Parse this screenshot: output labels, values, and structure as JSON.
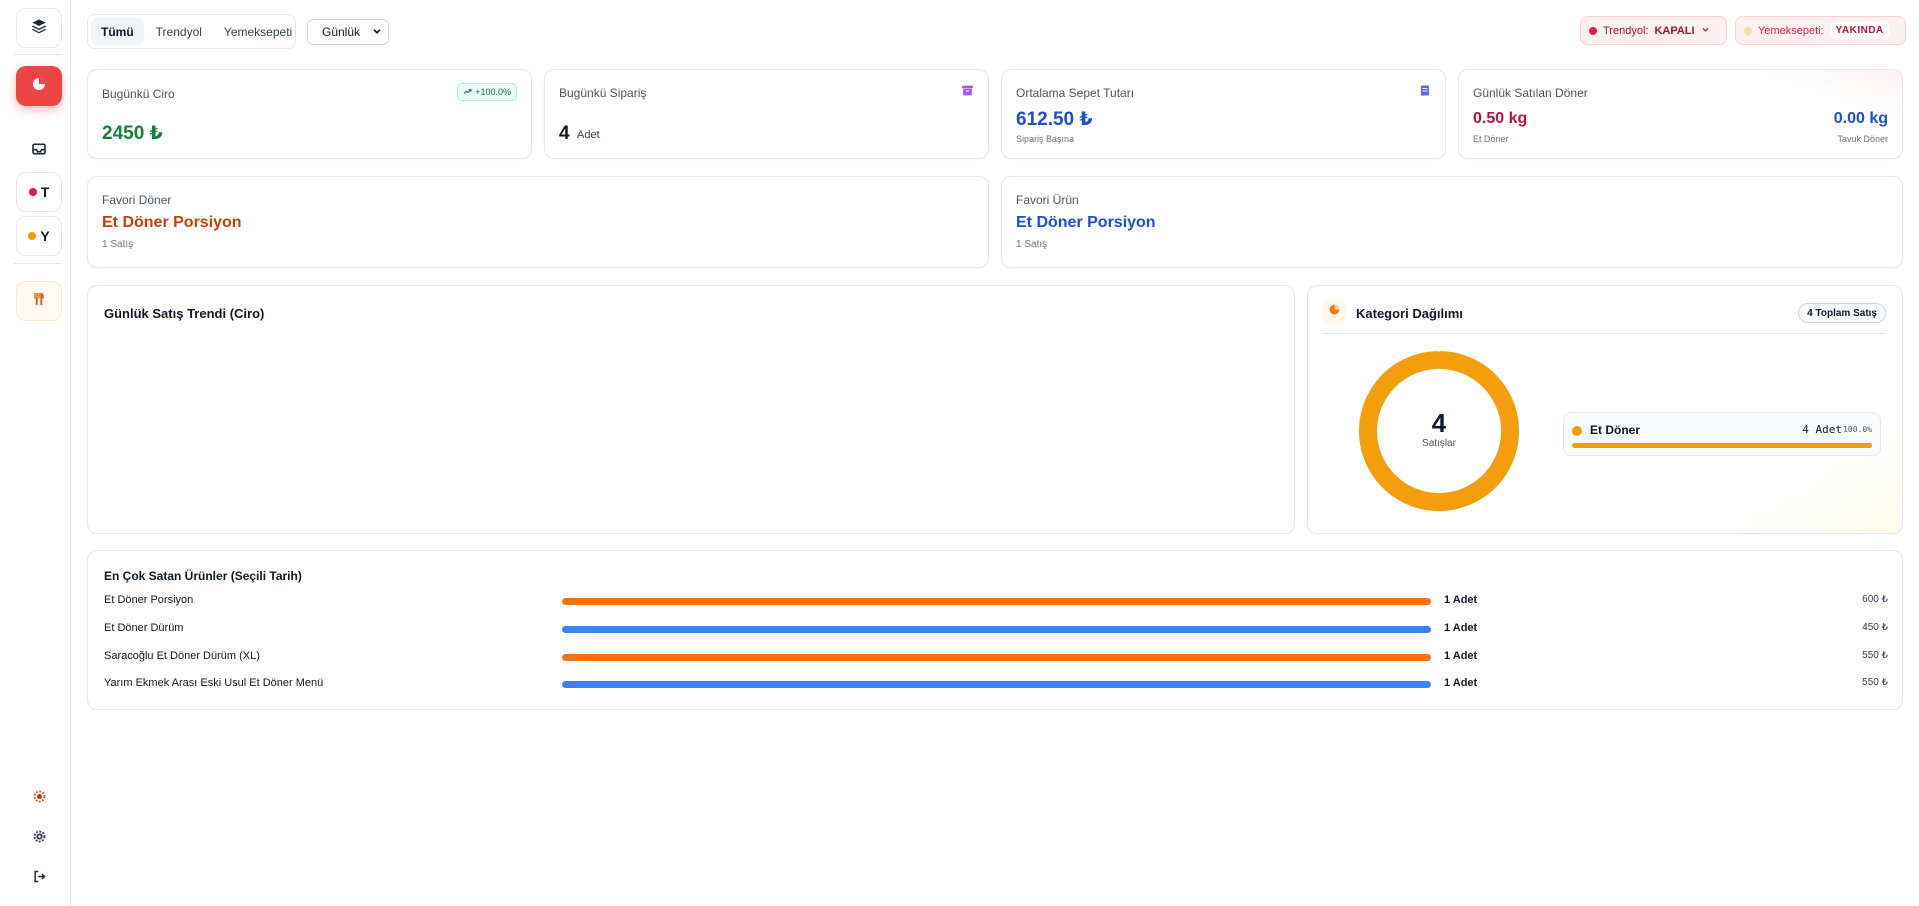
{
  "colors": {
    "accent_red": "#ef4444",
    "green": "#15803d",
    "blue": "#1d4ed8",
    "orange_text": "#c2410c",
    "crimson": "#be123c",
    "donut": "#f59e0b",
    "bar_orange": "#f97316",
    "bar_blue": "#3b82f6"
  },
  "sidebar": {
    "icons": [
      "layers-icon",
      "pie-chart-icon",
      "inbox-icon",
      "fork-knife-icon",
      "settings-red-icon",
      "settings-icon",
      "logout-icon"
    ],
    "platform_t": "T",
    "platform_y": "Y"
  },
  "topbar": {
    "tabs": [
      "Tümü",
      "Trendyol",
      "Yemeksepeti"
    ],
    "period": "Günlük",
    "trendyol": {
      "label": "Trendyol:",
      "status": "KAPALI"
    },
    "yemeksepeti": {
      "label": "Yemeksepeti:",
      "status": "YAKINDA"
    }
  },
  "stats": {
    "ciro": {
      "label": "Bugünkü Ciro",
      "value": "2450 ₺",
      "change": "+100.0%"
    },
    "siparis": {
      "label": "Bugünkü Sipariş",
      "value": "4",
      "unit": "Adet"
    },
    "sepet": {
      "label": "Ortalama Sepet Tutarı",
      "value": "612.50 ₺",
      "sub": "Sipariş Başına"
    },
    "doner": {
      "label": "Günlük Satılan Döner",
      "et_value": "0.50 kg",
      "et_label": "Et Döner",
      "tavuk_value": "0.00 kg",
      "tavuk_label": "Tavuk Döner"
    }
  },
  "favorites": {
    "doner": {
      "label": "Favori Döner",
      "name": "Et Döner Porsiyon",
      "sub": "1 Satış"
    },
    "urun": {
      "label": "Favori Ürün",
      "name": "Et Döner Porsiyon",
      "sub": "1 Satış"
    }
  },
  "trend": {
    "title": "Günlük Satış Trendi (Ciro)"
  },
  "category": {
    "title": "Kategori Dağılımı",
    "badge": "4 Toplam Satış",
    "center_value": "4",
    "center_label": "Satışlar",
    "items": [
      {
        "name": "Et Döner",
        "count": "4 Adet",
        "pct": "100.0%"
      }
    ]
  },
  "chart_data": {
    "type": "pie",
    "categories": [
      "Et Döner"
    ],
    "values": [
      4
    ],
    "title": "Kategori Dağılımı"
  },
  "top_products": {
    "title": "En Çok Satan Ürünler (Seçili Tarih)",
    "rows": [
      {
        "name": "Et Döner Porsiyon",
        "qty": "1 Adet",
        "price": "600 ₺",
        "fill": 1.0,
        "color": "#f97316"
      },
      {
        "name": "Et Döner Dürüm",
        "qty": "1 Adet",
        "price": "450 ₺",
        "fill": 1.0,
        "color": "#3b82f6"
      },
      {
        "name": "Saracoğlu Et Döner Dürüm (XL)",
        "qty": "1 Adet",
        "price": "550 ₺",
        "fill": 1.0,
        "color": "#f97316"
      },
      {
        "name": "Yarım Ekmek Arası Eski Usul Et Döner Menü",
        "qty": "1 Adet",
        "price": "550 ₺",
        "fill": 1.0,
        "color": "#3b82f6"
      }
    ]
  }
}
